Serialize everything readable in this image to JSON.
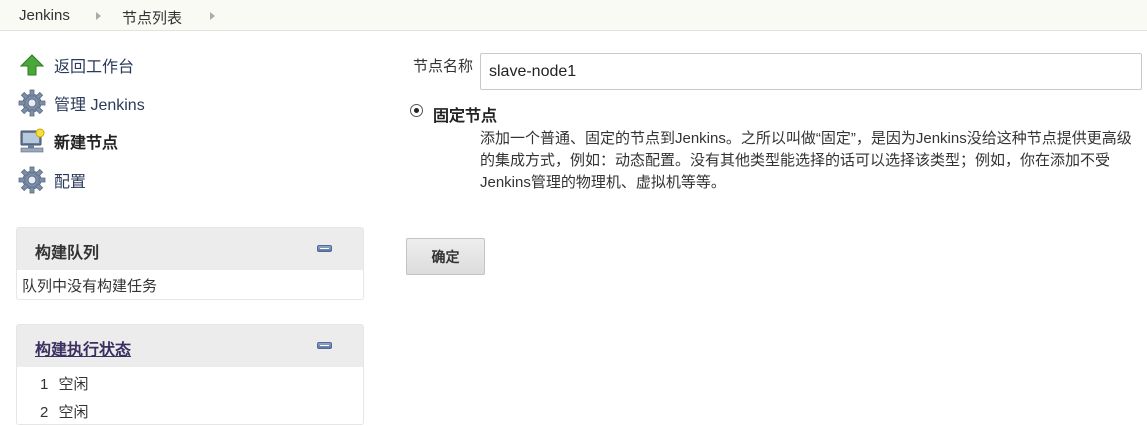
{
  "breadcrumb": {
    "items": [
      "Jenkins",
      "节点列表"
    ]
  },
  "tasks": [
    {
      "label": "返回工作台",
      "icon": "up-arrow-icon"
    },
    {
      "label": "管理 Jenkins",
      "icon": "gear-icon"
    },
    {
      "label": "新建节点",
      "icon": "computer-icon"
    },
    {
      "label": "配置",
      "icon": "gear-icon"
    }
  ],
  "build_queue": {
    "title": "构建队列",
    "empty_text": "队列中没有构建任务"
  },
  "executors": {
    "title": "构建执行状态",
    "rows": [
      {
        "number": "1",
        "status": "空闲"
      },
      {
        "number": "2",
        "status": "空闲"
      }
    ]
  },
  "form": {
    "name_label": "节点名称",
    "name_value": "slave-node1",
    "option_label": "固定节点",
    "option_description": "添加一个普通、固定的节点到Jenkins。之所以叫做“固定”，是因为Jenkins没给这种节点提供更高级的集成方式，例如：动态配置。没有其他类型能选择的话可以选择该类型；例如，你在添加不受Jenkins管理的物理机、虚拟机等等。",
    "ok_label": "确定"
  }
}
